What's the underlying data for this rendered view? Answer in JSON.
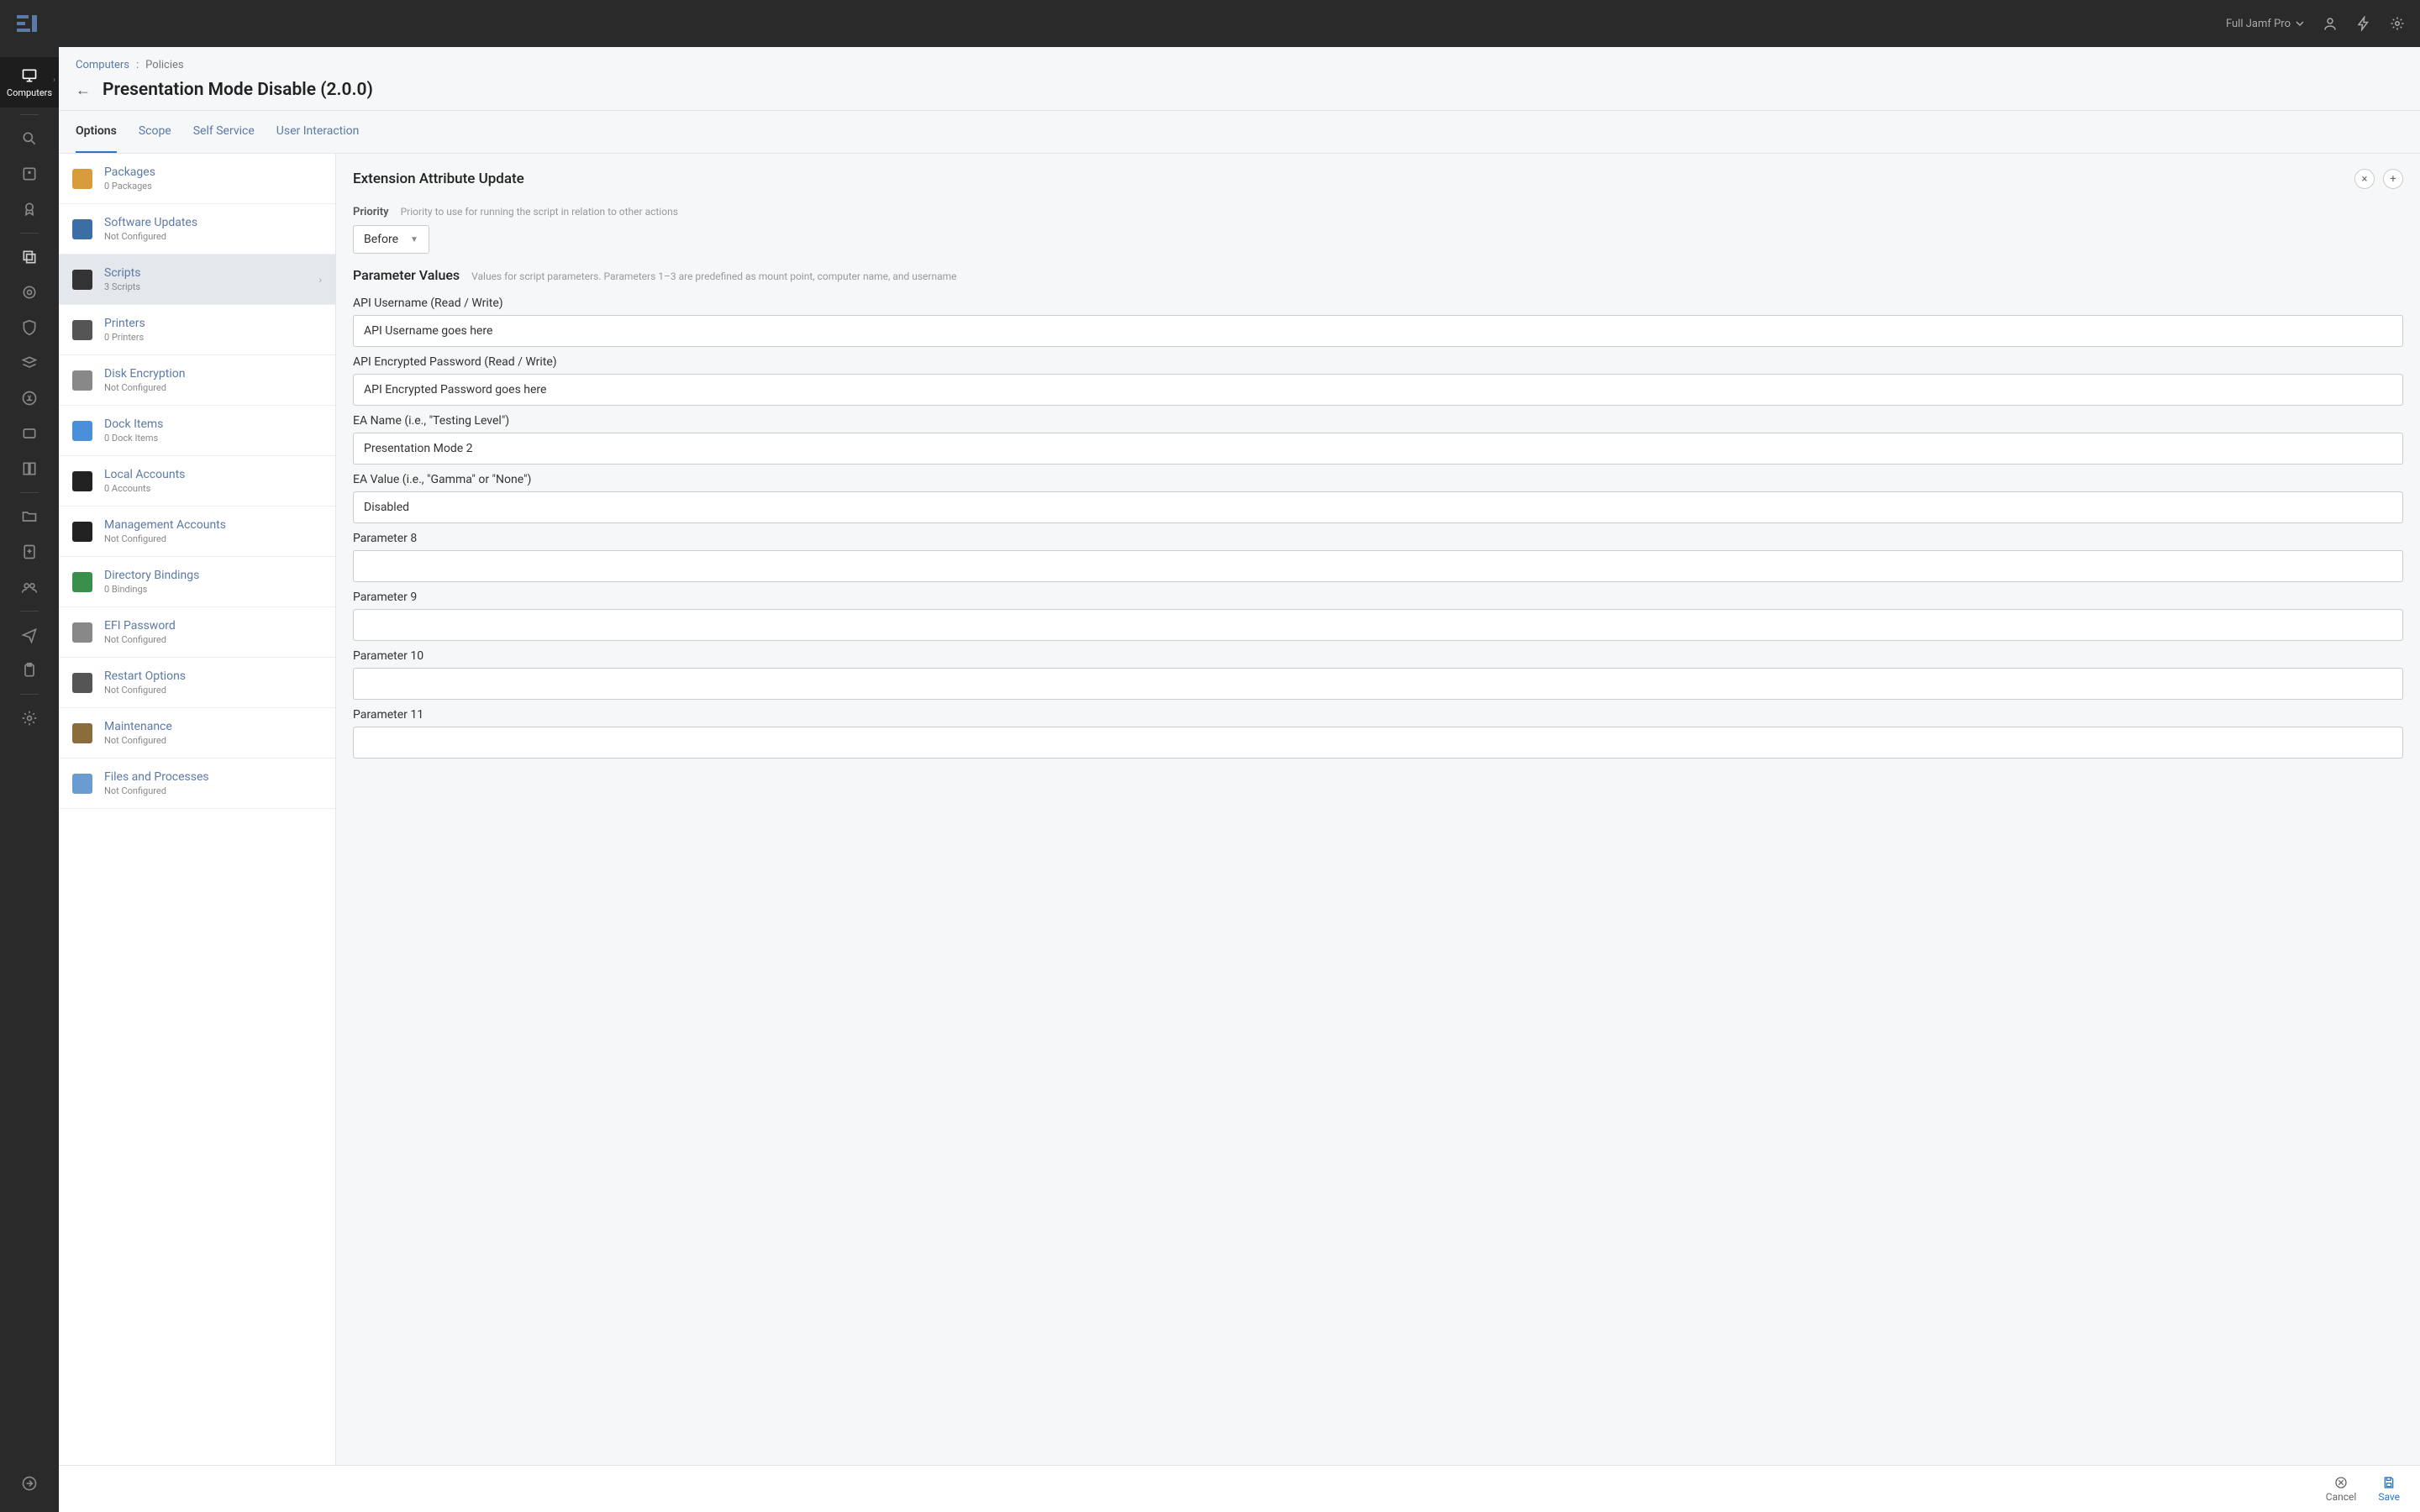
{
  "tenant": "Full Jamf Pro",
  "rail": {
    "active_label": "Computers"
  },
  "breadcrumb": {
    "root": "Computers",
    "sep": ":",
    "page": "Policies"
  },
  "title": "Presentation Mode Disable (2.0.0)",
  "tabs": {
    "options": "Options",
    "scope": "Scope",
    "self_service": "Self Service",
    "user_interaction": "User Interaction"
  },
  "payloads": [
    {
      "title": "Packages",
      "sub": "0 Packages"
    },
    {
      "title": "Software Updates",
      "sub": "Not Configured"
    },
    {
      "title": "Scripts",
      "sub": "3 Scripts"
    },
    {
      "title": "Printers",
      "sub": "0 Printers"
    },
    {
      "title": "Disk Encryption",
      "sub": "Not Configured"
    },
    {
      "title": "Dock Items",
      "sub": "0 Dock Items"
    },
    {
      "title": "Local Accounts",
      "sub": "0 Accounts"
    },
    {
      "title": "Management Accounts",
      "sub": "Not Configured"
    },
    {
      "title": "Directory Bindings",
      "sub": "0 Bindings"
    },
    {
      "title": "EFI Password",
      "sub": "Not Configured"
    },
    {
      "title": "Restart Options",
      "sub": "Not Configured"
    },
    {
      "title": "Maintenance",
      "sub": "Not Configured"
    },
    {
      "title": "Files and Processes",
      "sub": "Not Configured"
    }
  ],
  "detail": {
    "section_title": "Extension Attribute Update",
    "priority": {
      "label": "Priority",
      "hint": "Priority to use for running the script in relation to other actions",
      "value": "Before"
    },
    "param_values": {
      "heading": "Parameter Values",
      "hint": "Values for script parameters. Parameters 1–3 are predefined as mount point, computer name, and username"
    },
    "params": [
      {
        "label": "API Username (Read / Write)",
        "value": "API Username goes here"
      },
      {
        "label": "API Encrypted Password (Read / Write)",
        "value": "API Encrypted Password goes here"
      },
      {
        "label": "EA Name (i.e., \"Testing Level\")",
        "value": "Presentation Mode 2"
      },
      {
        "label": "EA Value (i.e., \"Gamma\" or \"None\")",
        "value": "Disabled"
      },
      {
        "label": "Parameter 8",
        "value": ""
      },
      {
        "label": "Parameter 9",
        "value": ""
      },
      {
        "label": "Parameter 10",
        "value": ""
      },
      {
        "label": "Parameter 11",
        "value": ""
      }
    ]
  },
  "footer": {
    "cancel": "Cancel",
    "save": "Save"
  },
  "payload_icons": {
    "Packages": "#d99c3b",
    "Software Updates": "#3a6ea5",
    "Scripts": "#333333",
    "Printers": "#555555",
    "Disk Encryption": "#888888",
    "Dock Items": "#4a90d9",
    "Local Accounts": "#222222",
    "Management Accounts": "#222222",
    "Directory Bindings": "#3a8f4a",
    "EFI Password": "#888888",
    "Restart Options": "#555555",
    "Maintenance": "#8a6d3b",
    "Files and Processes": "#6a9bd1"
  }
}
